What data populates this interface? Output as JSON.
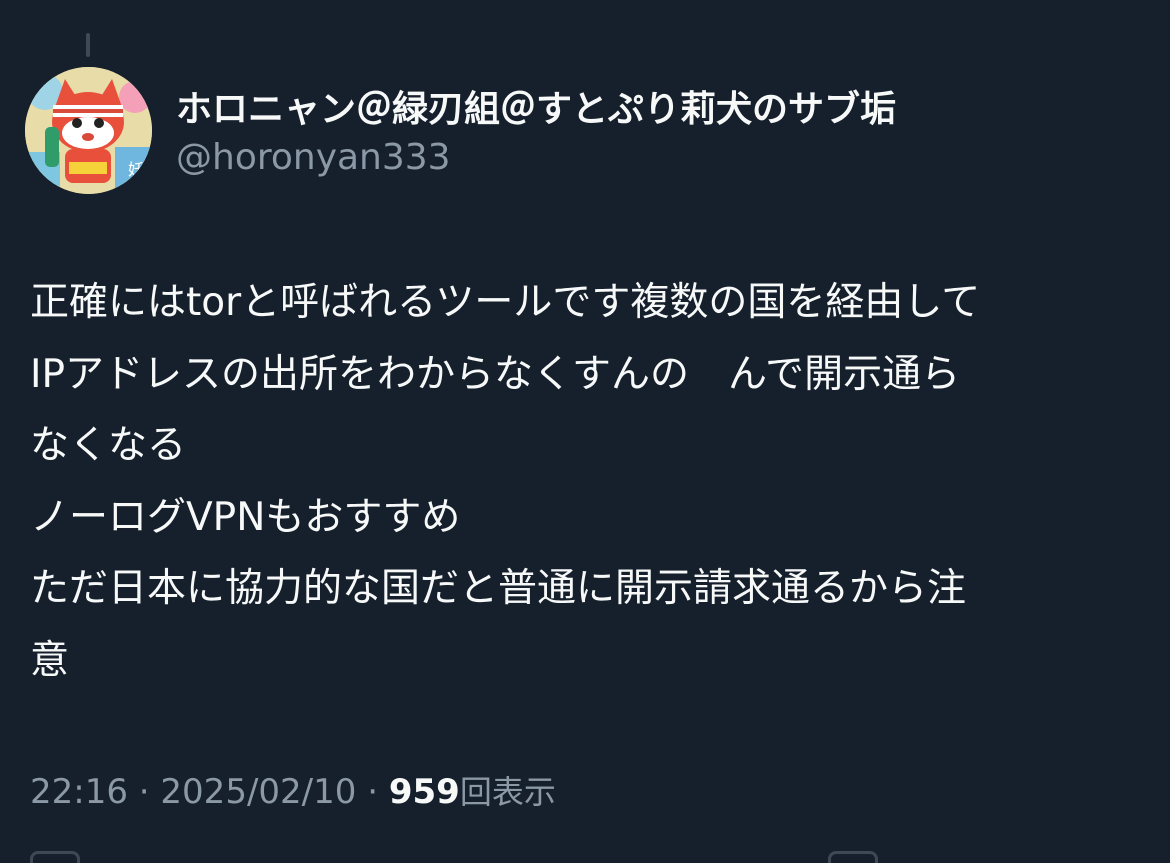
{
  "author": {
    "display_name": "ホロニャン＠緑刃組＠すとぷり莉犬のサブ垢",
    "handle": "@horonyan333"
  },
  "tweet": {
    "lines": [
      "正確にはtorと呼ばれるツールです複数の国を経由して",
      "IPアドレスの出所をわからなくすんの　んで開示通ら",
      "なくなる",
      "ノーログVPNもおすすめ",
      "ただ日本に協力的な国だと普通に開示請求通るから注",
      "意"
    ]
  },
  "meta": {
    "time": "22:16",
    "separator": "·",
    "date": "2025/02/10",
    "views_count": "959",
    "views_label": "回表示"
  },
  "colors": {
    "background": "#16202c",
    "text_primary": "#f7f9f9",
    "text_secondary": "#8b98a5"
  }
}
